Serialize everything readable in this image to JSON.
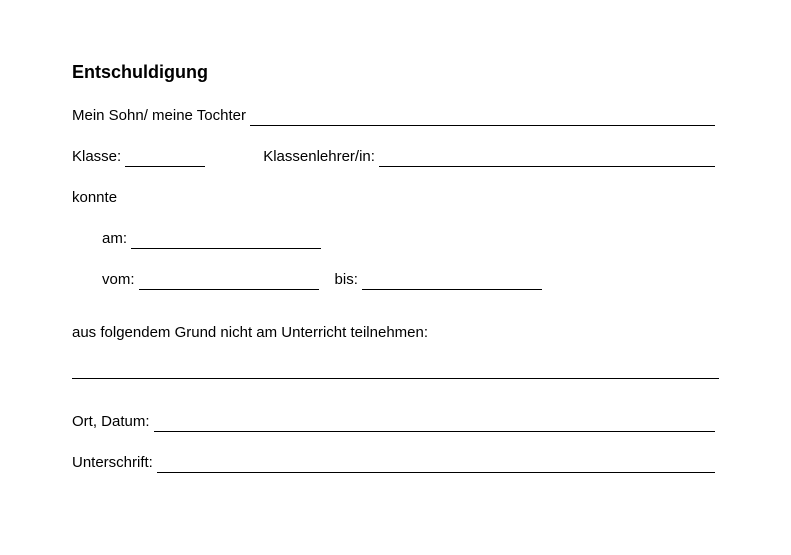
{
  "title": "Entschuldigung",
  "line1": {
    "label": "Mein Sohn/ meine Tochter"
  },
  "line2": {
    "klasse_label": "Klasse:",
    "lehrer_label": "Klassenlehrer/in:"
  },
  "line3": {
    "label": "konnte"
  },
  "line4": {
    "am_label": "am:"
  },
  "line5": {
    "vom_label": "vom:",
    "bis_label": "bis:"
  },
  "line6": {
    "label": "aus folgendem Grund nicht am Unterricht teilnehmen:"
  },
  "line7": {
    "ort_label": "Ort, Datum:"
  },
  "line8": {
    "unterschrift_label": "Unterschrift:"
  }
}
